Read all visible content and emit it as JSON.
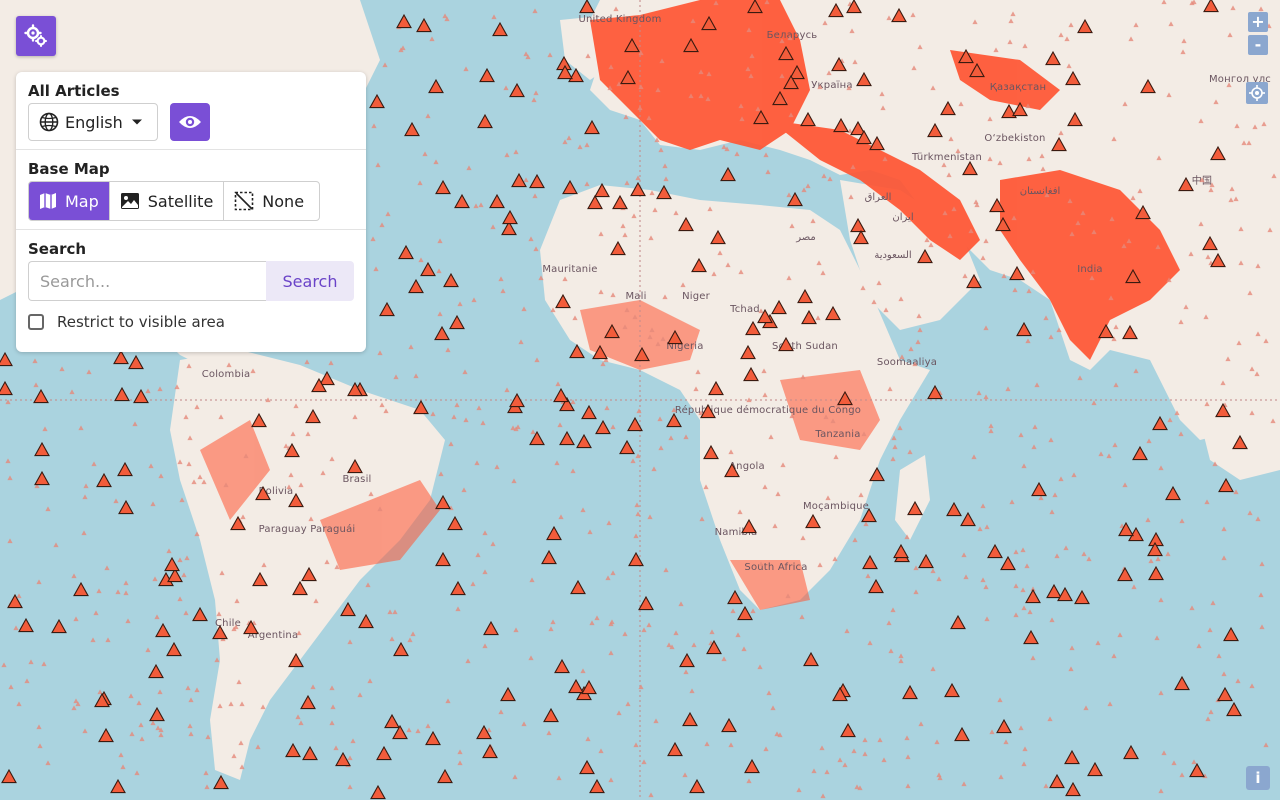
{
  "settings": {
    "icon": "gears-icon"
  },
  "panel": {
    "articles_title": "All Articles",
    "language": "English",
    "eye_icon": "eye-icon",
    "basemap_title": "Base Map",
    "basemap_options": [
      "Map",
      "Satellite",
      "None"
    ],
    "basemap_selected": "Map",
    "search_title": "Search",
    "search_placeholder": "Search...",
    "search_value": "",
    "search_button": "Search",
    "restrict_label": "Restrict to visible area",
    "restrict_checked": false
  },
  "map_controls": {
    "zoom_in": "+",
    "zoom_out": "-",
    "locate_icon": "crosshair-icon",
    "info": "i"
  },
  "map_labels": [
    "United Kingdom",
    "Беларусь",
    "Україна",
    "Қазақстан",
    "Монгол улс",
    "O‘zbekiston",
    "Türkmenistan",
    "افغانستان",
    "中国",
    "ایران",
    "العراق",
    "مصر",
    "السعودية",
    "India",
    "Mauritanie",
    "Mali",
    "Niger",
    "Tchad",
    "Nigeria",
    "South Sudan",
    "Soomaaliya",
    "République démocratique du Congo",
    "Tanzania",
    "Angola",
    "Namibia",
    "Moçambique",
    "South Africa",
    "Colombia",
    "Brasil",
    "Bolivia",
    "Paraguay Paraguái",
    "Chile",
    "Argentina"
  ],
  "colors": {
    "accent": "#7a4fd6",
    "land": "#f3ece5",
    "water": "#aad3df",
    "density": "#ff5533",
    "marker": "#f25c3b",
    "control": "#8ba7cf"
  }
}
